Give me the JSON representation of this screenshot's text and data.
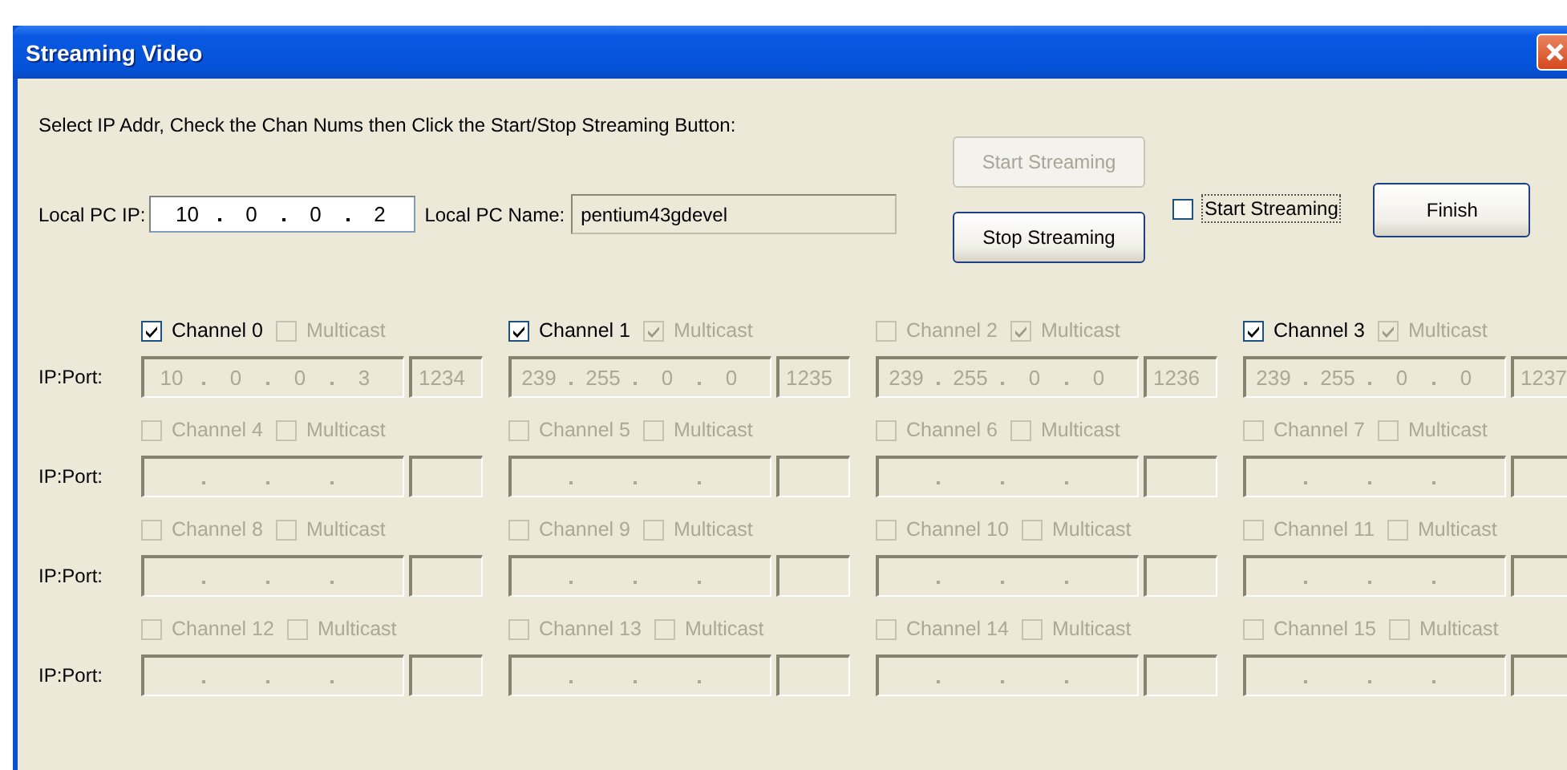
{
  "window": {
    "title": "Streaming Video"
  },
  "instructions": "Select IP Addr, Check the Chan Nums then Click the Start/Stop Streaming Button:",
  "local_ip": {
    "label": "Local PC IP:",
    "octets": [
      "10",
      "0",
      "0",
      "2"
    ]
  },
  "local_name": {
    "label": "Local PC Name:",
    "value": "pentium43gdevel"
  },
  "buttons": [
    {
      "label": "Start Streaming",
      "disabled": true
    },
    {
      "label": "Stop Streaming",
      "disabled": false
    }
  ],
  "stream_checkbox": {
    "label": "Start Streaming",
    "checked": false,
    "focused": true
  },
  "finish_button": {
    "label": "Finish"
  },
  "channel_rows": [
    {
      "label": "IP:Port:",
      "channels": [
        {
          "label": "Channel 0",
          "checked": true,
          "disabled": false,
          "multicast": {
            "label": "Multicast",
            "checked": false,
            "disabled": true
          },
          "address_disabled": true,
          "octets": [
            "10",
            "0",
            "0",
            "3"
          ],
          "port": "1234"
        },
        {
          "label": "Channel 1",
          "checked": true,
          "disabled": false,
          "multicast": {
            "label": "Multicast",
            "checked": true,
            "disabled": true
          },
          "address_disabled": true,
          "octets": [
            "239",
            "255",
            "0",
            "0"
          ],
          "port": "1235"
        },
        {
          "label": "Channel 2",
          "checked": false,
          "disabled": true,
          "multicast": {
            "label": "Multicast",
            "checked": true,
            "disabled": true
          },
          "address_disabled": true,
          "octets": [
            "239",
            "255",
            "0",
            "0"
          ],
          "port": "1236"
        },
        {
          "label": "Channel 3",
          "checked": true,
          "disabled": false,
          "multicast": {
            "label": "Multicast",
            "checked": true,
            "disabled": true
          },
          "address_disabled": true,
          "octets": [
            "239",
            "255",
            "0",
            "0"
          ],
          "port": "1237"
        }
      ]
    },
    {
      "label": "IP:Port:",
      "channels": [
        {
          "label": "Channel 4",
          "checked": false,
          "disabled": true,
          "multicast": {
            "label": "Multicast",
            "checked": false,
            "disabled": true
          },
          "address_disabled": true
        },
        {
          "label": "Channel 5",
          "checked": false,
          "disabled": true,
          "multicast": {
            "label": "Multicast",
            "checked": false,
            "disabled": true
          },
          "address_disabled": true
        },
        {
          "label": "Channel 6",
          "checked": false,
          "disabled": true,
          "multicast": {
            "label": "Multicast",
            "checked": false,
            "disabled": true
          },
          "address_disabled": true
        },
        {
          "label": "Channel 7",
          "checked": false,
          "disabled": true,
          "multicast": {
            "label": "Multicast",
            "checked": false,
            "disabled": true
          },
          "address_disabled": true
        }
      ]
    },
    {
      "label": "IP:Port:",
      "channels": [
        {
          "label": "Channel 8",
          "checked": false,
          "disabled": true,
          "multicast": {
            "label": "Multicast",
            "checked": false,
            "disabled": true
          },
          "address_disabled": true
        },
        {
          "label": "Channel 9",
          "checked": false,
          "disabled": true,
          "multicast": {
            "label": "Multicast",
            "checked": false,
            "disabled": true
          },
          "address_disabled": true
        },
        {
          "label": "Channel 10",
          "checked": false,
          "disabled": true,
          "multicast": {
            "label": "Multicast",
            "checked": false,
            "disabled": true
          },
          "address_disabled": true
        },
        {
          "label": "Channel 11",
          "checked": false,
          "disabled": true,
          "multicast": {
            "label": "Multicast",
            "checked": false,
            "disabled": true
          },
          "address_disabled": true
        }
      ]
    },
    {
      "label": "IP:Port:",
      "channels": [
        {
          "label": "Channel 12",
          "checked": false,
          "disabled": true,
          "multicast": {
            "label": "Multicast",
            "checked": false,
            "disabled": true
          },
          "address_disabled": true
        },
        {
          "label": "Channel 13",
          "checked": false,
          "disabled": true,
          "multicast": {
            "label": "Multicast",
            "checked": false,
            "disabled": true
          },
          "address_disabled": true
        },
        {
          "label": "Channel 14",
          "checked": false,
          "disabled": true,
          "multicast": {
            "label": "Multicast",
            "checked": false,
            "disabled": true
          },
          "address_disabled": true
        },
        {
          "label": "Channel 15",
          "checked": false,
          "disabled": true,
          "multicast": {
            "label": "Multicast",
            "checked": false,
            "disabled": true
          },
          "address_disabled": true
        }
      ]
    }
  ]
}
